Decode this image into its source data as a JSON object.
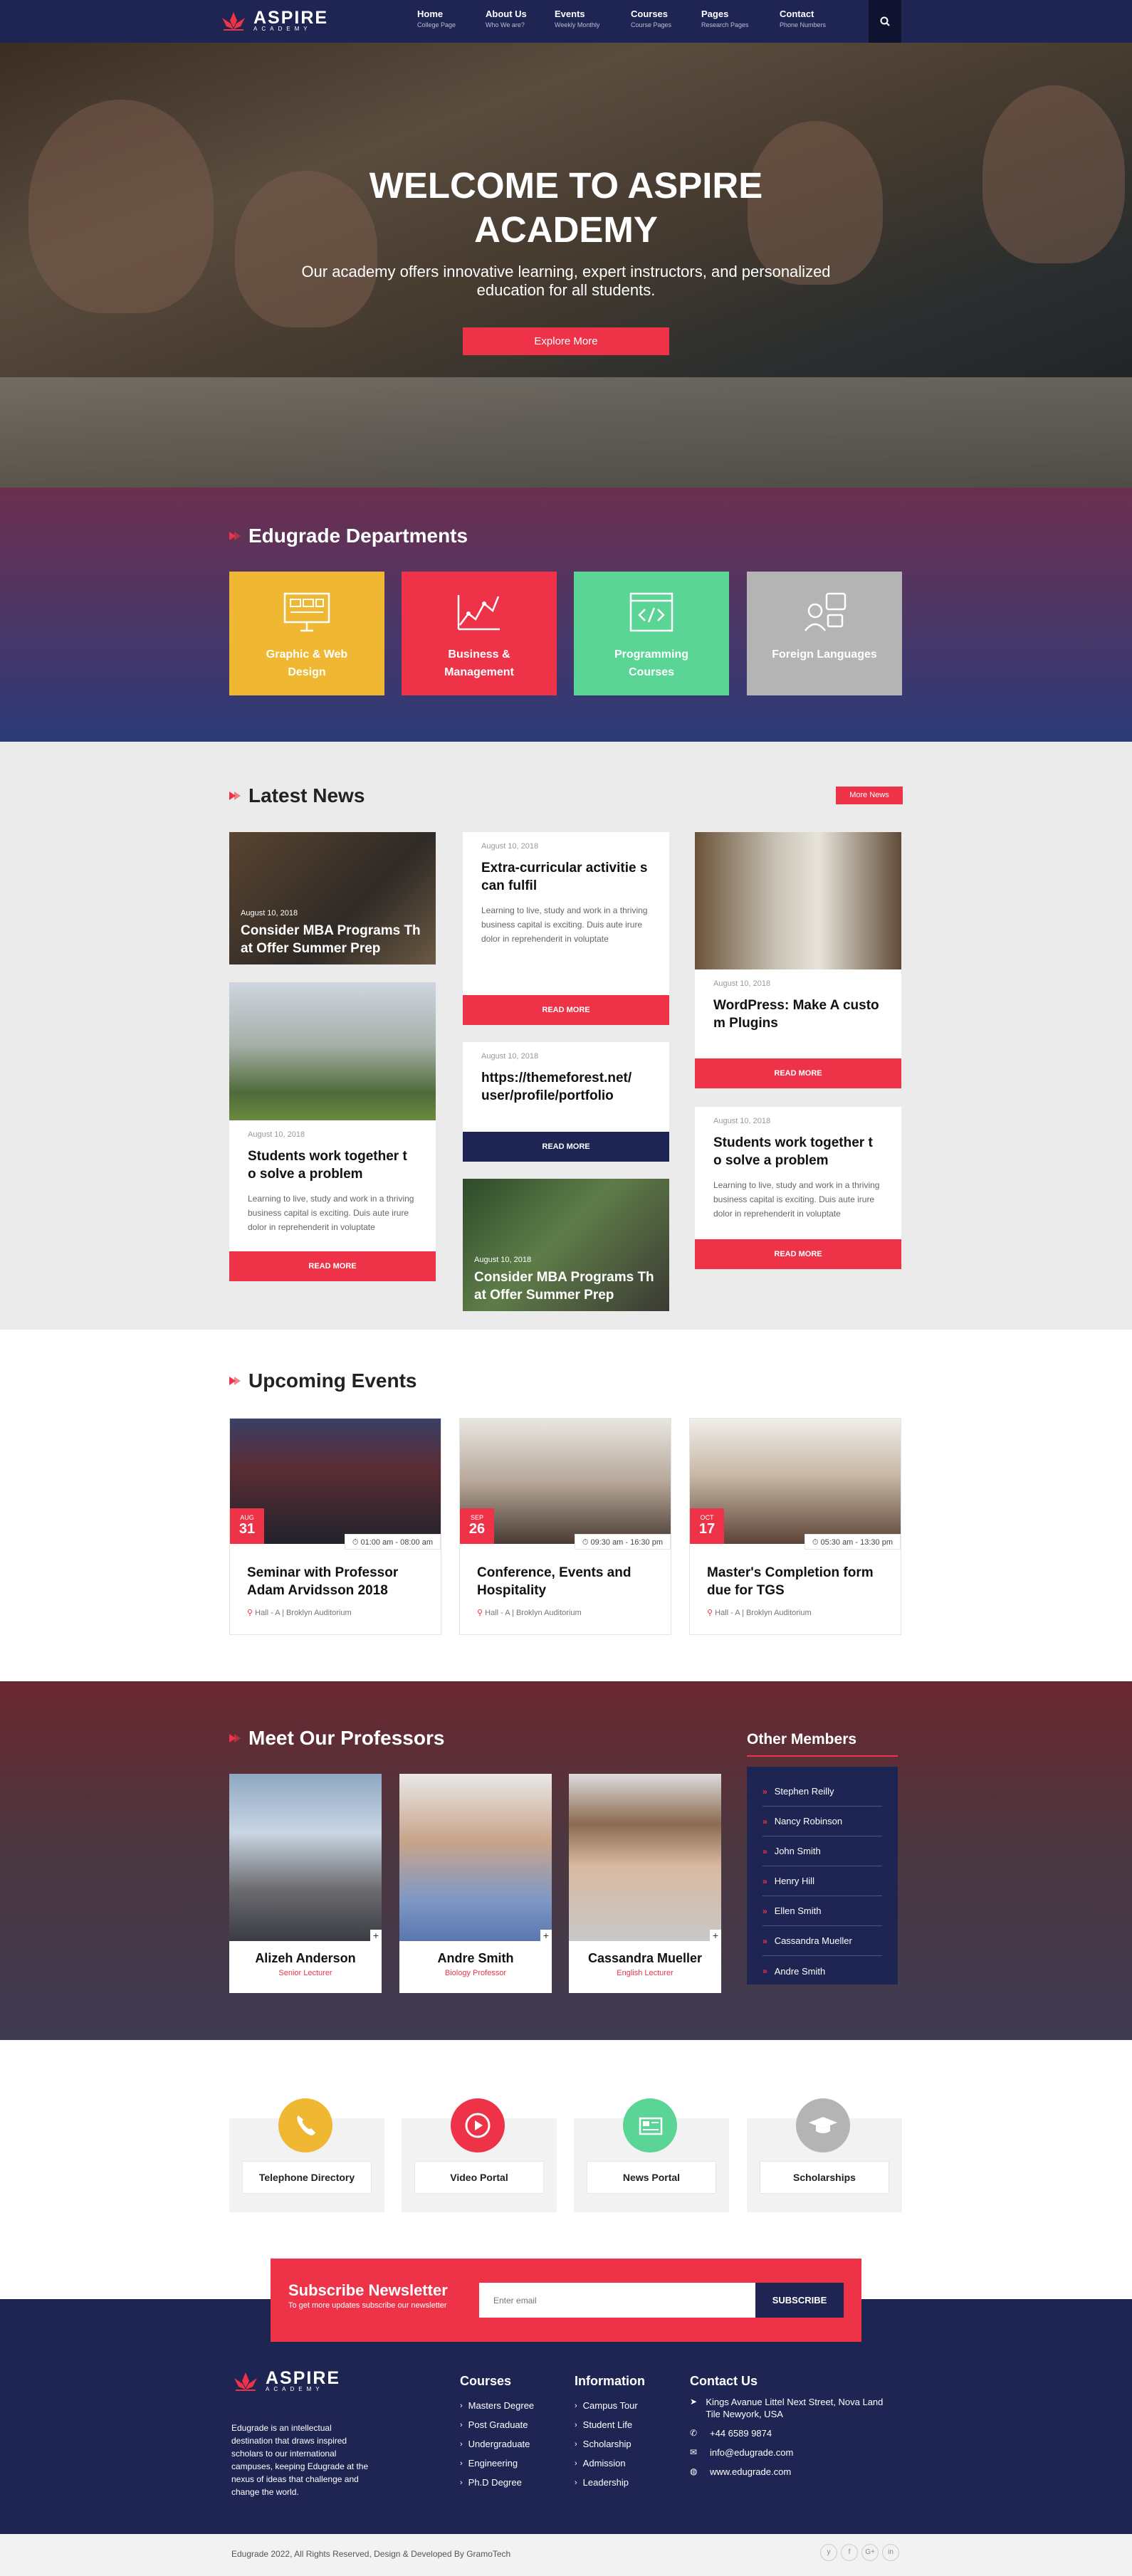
{
  "brand": {
    "name": "ASPIRE",
    "sub": "ACADEMY"
  },
  "nav": [
    {
      "label": "Home",
      "sub": "College Page"
    },
    {
      "label": "About Us",
      "sub": "Who We are?"
    },
    {
      "label": "Events",
      "sub": "Weekly Monthly"
    },
    {
      "label": "Courses",
      "sub": "Course Pages"
    },
    {
      "label": "Pages",
      "sub": "Research Pages"
    },
    {
      "label": "Contact",
      "sub": "Phone Numbers"
    }
  ],
  "hero": {
    "title": "WELCOME TO ASPIRE ACADEMY",
    "subtitle": "Our academy offers innovative learning, expert instructors, and personalized education for all students.",
    "button": "Explore More"
  },
  "departments": {
    "title": "Edugrade Departments",
    "items": [
      {
        "label": "Graphic & Web Design",
        "color": "#f0b732",
        "icon": "monitor-icon"
      },
      {
        "label": "Business & Management",
        "color": "#ee3348",
        "icon": "chart-icon"
      },
      {
        "label": "Programming Courses",
        "color": "#5bd595",
        "icon": "code-icon"
      },
      {
        "label": "Foreign Languages",
        "color": "#b4b4b4",
        "icon": "translate-icon"
      }
    ]
  },
  "news": {
    "title": "Latest News",
    "more": "More News",
    "read_more": "READ MORE",
    "cards": [
      {
        "date": "August 10, 2018",
        "title": "Consider MBA Programs Th at Offer Summer Prep"
      },
      {
        "date": "August 10, 2018",
        "title": "Students work together t o solve a problem",
        "excerpt": "Learning to live, study and work in a thriving business capital is exciting. Duis aute irure dolor in reprehenderit in voluptate"
      },
      {
        "date": "August 10, 2018",
        "title": "Extra-curricular activitie s can fulfil",
        "excerpt": "Learning to live, study and work in a thriving business capital is exciting. Duis aute irure dolor in reprehenderit in voluptate"
      },
      {
        "date": "August 10, 2018",
        "title": "https://themeforest.net/ user/profile/portfolio"
      },
      {
        "date": "August 10, 2018",
        "title": "Consider MBA Programs Th at Offer Summer Prep"
      },
      {
        "date": "August 10, 2018",
        "title": "WordPress: Make A custo m Plugins"
      },
      {
        "date": "August 10, 2018",
        "title": "Students work together t o solve a problem",
        "excerpt": "Learning to live, study and work in a thriving business capital is exciting. Duis aute irure dolor in reprehenderit in voluptate"
      }
    ]
  },
  "events": {
    "title": "Upcoming Events",
    "items": [
      {
        "month": "AUG",
        "day": "31",
        "time": "01:00 am - 08:00 am",
        "title": "Seminar with Professor Adam Arvidsson 2018",
        "location": "Hall - A | Broklyn Auditorium"
      },
      {
        "month": "SEP",
        "day": "26",
        "time": "09:30 am - 16:30 pm",
        "title": "Conference, Events and Hospitality",
        "location": "Hall - A | Broklyn Auditorium"
      },
      {
        "month": "OCT",
        "day": "17",
        "time": "05:30 am - 13:30 pm",
        "title": "Master's Completion form due for TGS",
        "location": "Hall - A | Broklyn Auditorium"
      }
    ]
  },
  "professors": {
    "title": "Meet Our Professors",
    "items": [
      {
        "name": "Alizeh Anderson",
        "role": "Senior Lecturer"
      },
      {
        "name": "Andre Smith",
        "role": "Biology Professor"
      },
      {
        "name": "Cassandra Mueller",
        "role": "English Lecturer"
      }
    ],
    "others_title": "Other Members",
    "others": [
      "Stephen Reilly",
      "Nancy Robinson",
      "John Smith",
      "Henry Hill",
      "Ellen Smith",
      "Cassandra Mueller",
      "Andre Smith"
    ]
  },
  "services": [
    {
      "label": "Telephone Directory",
      "color": "#f0b732",
      "icon": "phone-icon"
    },
    {
      "label": "Video Portal",
      "color": "#ee3348",
      "icon": "play-icon"
    },
    {
      "label": "News Portal",
      "color": "#5bd595",
      "icon": "newspaper-icon"
    },
    {
      "label": "Scholarships",
      "color": "#b4b4b4",
      "icon": "graduation-cap-icon"
    }
  ],
  "newsletter": {
    "title": "Subscribe Newsletter",
    "subtitle": "To get more updates subscribe our newsletter",
    "placeholder": "Enter email",
    "button": "SUBSCRIBE"
  },
  "footer": {
    "about": "Edugrade is an intellectual destination that draws inspired scholars to our international campuses, keeping Edugrade at the nexus of ideas that challenge and change the world.",
    "courses_title": "Courses",
    "courses": [
      "Masters Degree",
      "Post Graduate",
      "Undergraduate",
      "Engineering",
      "Ph.D Degree"
    ],
    "info_title": "Information",
    "info": [
      "Campus Tour",
      "Student Life",
      "Scholarship",
      "Admission",
      "Leadership"
    ],
    "contact_title": "Contact Us",
    "address": "Kings Avanue Littel Next Street, Nova Land Tile Newyork, USA",
    "phone": "+44 6589 9874",
    "email": "info@edugrade.com",
    "web": "www.edugrade.com",
    "copyright": "Edugrade 2022, All Rights Reserved, Design & Developed By GramoTech",
    "social": [
      "y",
      "f",
      "G+",
      "in"
    ]
  },
  "colors": {
    "navy": "#1e2552",
    "accent": "#ee3348"
  }
}
